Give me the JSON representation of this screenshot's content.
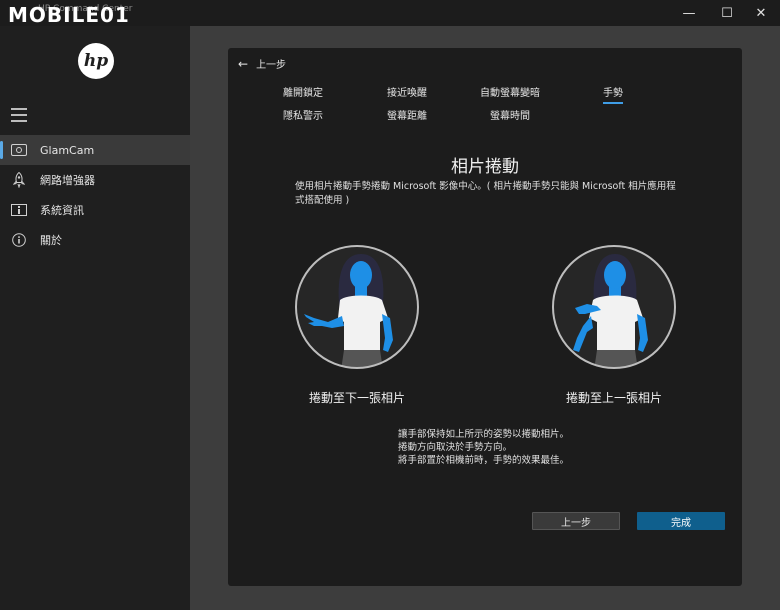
{
  "titlebar": {
    "watermark": "MOBILE01",
    "app_title": "HP Command Center",
    "minimize": "—",
    "maximize": "☐",
    "close": "✕"
  },
  "sidebar": {
    "logo_text": "hp",
    "items": [
      {
        "label": "GlamCam",
        "icon": "camera-icon",
        "active": true
      },
      {
        "label": "網路增強器",
        "icon": "rocket-icon",
        "active": false
      },
      {
        "label": "系統資訊",
        "icon": "info-box-icon",
        "active": false
      },
      {
        "label": "關於",
        "icon": "info-circle-icon",
        "active": false
      }
    ]
  },
  "dialog": {
    "back_label": "上一步",
    "tabs_row1": [
      "離開鎖定",
      "接近喚醒",
      "自動螢幕變暗",
      "手勢"
    ],
    "tabs_row2": [
      "隱私警示",
      "螢幕距離",
      "螢幕時間"
    ],
    "active_tab": "手勢",
    "heading": "相片捲動",
    "description": "使用相片捲動手勢捲動 Microsoft 影像中心。( 相片捲動手勢只能與 Microsoft 相片應用程式搭配使用 )",
    "illustrations": [
      {
        "caption": "捲動至下一張相片"
      },
      {
        "caption": "捲動至上一張相片"
      }
    ],
    "instructions": [
      "讓手部保持如上所示的姿勢以捲動相片。",
      "捲動方向取決於手勢方向。",
      "將手部置於相機前時，手勢的效果最佳。"
    ],
    "buttons": {
      "prev": "上一步",
      "done": "完成"
    }
  },
  "colors": {
    "accent": "#3f9de6",
    "done_button": "#0f5f8d",
    "figure_blue": "#1e8fe6",
    "shirt": "#f2f2f2",
    "hair": "#2a2a40"
  }
}
